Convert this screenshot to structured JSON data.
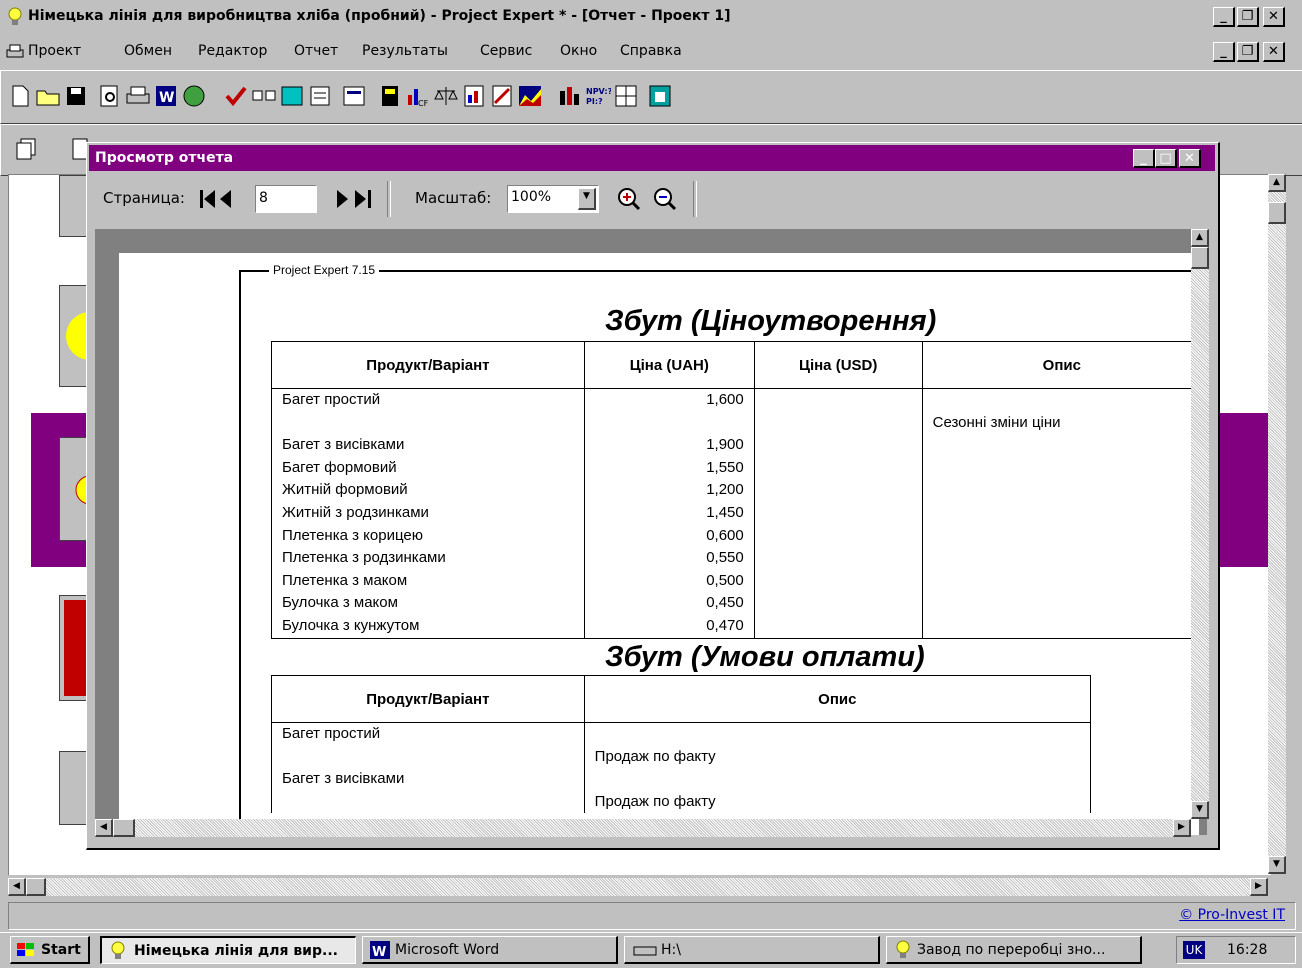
{
  "window": {
    "title": "Німецька лінія для виробництва хліба (пробний) - Project Expert * - [Отчет - Проект 1]"
  },
  "menubar": {
    "items": [
      "Проект",
      "Обмен",
      "Редактор",
      "Отчет",
      "Результаты",
      "Сервис",
      "Окно",
      "Справка"
    ]
  },
  "toolbar_icons": [
    "new-file-icon",
    "open-folder-icon",
    "save-icon",
    "print-preview-icon",
    "print-icon",
    "word-icon",
    "globe-icon",
    "check-icon",
    "compare-icon",
    "refresh-icon",
    "clipboard-icon",
    "screen-icon",
    "calculator-icon",
    "chart-cf-icon",
    "scales-icon",
    "chart-report-icon",
    "edit-chart-icon",
    "area-chart-icon",
    "bar-chart-icon",
    "npv-pi-icon",
    "grid-icon",
    "analysis-icon"
  ],
  "dialog": {
    "title": "Просмотр отчета",
    "page_label": "Страница:",
    "page_value": "8",
    "zoom_label": "Масштаб:",
    "zoom_value": "100%"
  },
  "report": {
    "frame_label": "Project Expert 7.15",
    "section1": {
      "title": "Збут (Ціноутворення)",
      "headers": [
        "Продукт/Варіант",
        "Ціна (UAH)",
        "Ціна (USD)",
        "Опис"
      ],
      "rows": [
        {
          "product": "Багет простий",
          "price": "1,600",
          "usd": "",
          "desc": ""
        },
        {
          "product": "",
          "price": "",
          "usd": "",
          "desc": "Сезонні зміни ціни"
        },
        {
          "product": "Багет з висівками",
          "price": "1,900",
          "usd": "",
          "desc": ""
        },
        {
          "product": "Багет формовий",
          "price": "1,550",
          "usd": "",
          "desc": ""
        },
        {
          "product": "Житній формовий",
          "price": "1,200",
          "usd": "",
          "desc": ""
        },
        {
          "product": "Житній з родзинками",
          "price": "1,450",
          "usd": "",
          "desc": ""
        },
        {
          "product": "Плетенка з корицею",
          "price": "0,600",
          "usd": "",
          "desc": ""
        },
        {
          "product": "Плетенка з родзинками",
          "price": "0,550",
          "usd": "",
          "desc": ""
        },
        {
          "product": "Плетенка з маком",
          "price": "0,500",
          "usd": "",
          "desc": ""
        },
        {
          "product": "Булочка з маком",
          "price": "0,450",
          "usd": "",
          "desc": ""
        },
        {
          "product": "Булочка з кунжутом",
          "price": "0,470",
          "usd": "",
          "desc": ""
        }
      ]
    },
    "section2": {
      "title": "Збут (Умови оплати)",
      "headers": [
        "Продукт/Варіант",
        "Опис"
      ],
      "rows": [
        {
          "product": "Багет простий",
          "desc": ""
        },
        {
          "product": "",
          "desc": "Продаж по факту"
        },
        {
          "product": "Багет з висівками",
          "desc": ""
        },
        {
          "product": "",
          "desc": "Продаж по факту"
        }
      ]
    }
  },
  "statusbar": {
    "copyright": "© Pro-Invest IT"
  },
  "taskbar": {
    "start": "Start",
    "tasks": [
      "Німецька лінія для вир...",
      "Microsoft Word",
      "H:\\",
      "Завод по переробці зно..."
    ],
    "lang": "UK",
    "clock": "16:28"
  }
}
